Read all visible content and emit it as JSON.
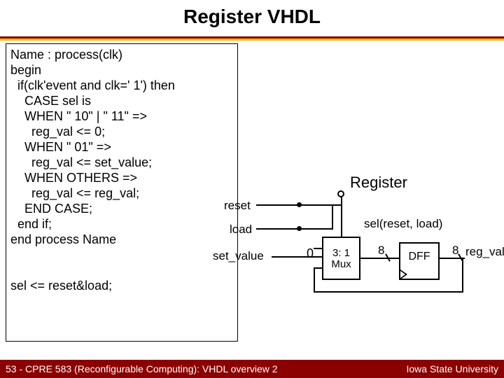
{
  "title": "Register VHDL",
  "code": "Name : process(clk)\nbegin\n  if(clk'event and clk=' 1') then\n    CASE sel is\n    WHEN \" 10\" | \" 11\" =>\n      reg_val <= 0;\n    WHEN \" 01\" =>\n      reg_val <= set_value;\n    WHEN OTHERS =>\n      reg_val <= reg_val;\n    END CASE;\n  end if;\nend process Name\n\n\nsel <= reset&load;",
  "diagram": {
    "register": "Register",
    "reset": "reset",
    "load": "load",
    "set_value": "set_value",
    "zero": "0",
    "sel": "sel(reset, load)",
    "mux": "3: 1\nMux",
    "dff": "DFF",
    "bus8": "8",
    "reg_val": "reg_val"
  },
  "footer": {
    "left": "53 - CPRE 583 (Reconfigurable Computing):  VHDL overview 2",
    "right": "Iowa State University"
  }
}
